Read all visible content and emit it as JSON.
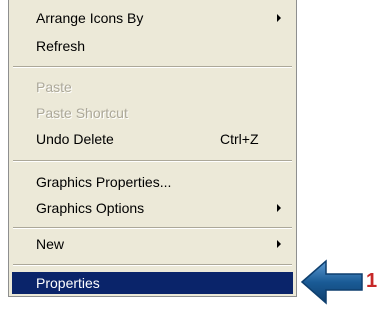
{
  "menu": {
    "items": [
      {
        "label": "Arrange Icons By",
        "submenu": true
      },
      {
        "label": "Refresh"
      },
      {
        "label": "Paste",
        "disabled": true
      },
      {
        "label": "Paste Shortcut",
        "disabled": true
      },
      {
        "label": "Undo Delete",
        "shortcut": "Ctrl+Z"
      },
      {
        "label": "Graphics Properties..."
      },
      {
        "label": "Graphics Options",
        "submenu": true
      },
      {
        "label": "New",
        "submenu": true
      },
      {
        "label": "Properties",
        "highlighted": true
      }
    ]
  },
  "callout": {
    "number": "1",
    "arrow_color": "#1a5b96",
    "number_color": "#c62828"
  },
  "colors": {
    "menu_background": "#ece9d8",
    "highlight": "#0a246a",
    "disabled_text": "#aca899"
  }
}
